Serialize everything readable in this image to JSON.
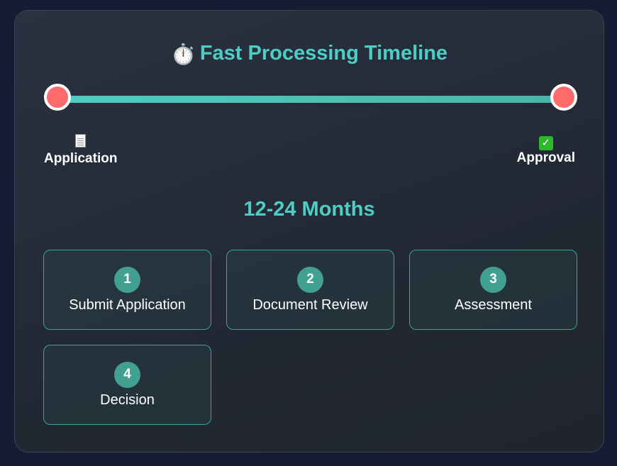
{
  "header": {
    "icon": "stopwatch-icon",
    "emoji": "⏱️",
    "title": "Fast Processing Timeline"
  },
  "timeline": {
    "start": {
      "icon": "document-icon",
      "label": "Application"
    },
    "end": {
      "icon": "check-mark-icon",
      "label": "Approval"
    },
    "duration": "12-24 Months"
  },
  "steps": [
    {
      "number": "1",
      "label": "Submit Application"
    },
    {
      "number": "2",
      "label": "Document Review"
    },
    {
      "number": "3",
      "label": "Assessment"
    },
    {
      "number": "4",
      "label": "Decision"
    }
  ],
  "colors": {
    "accent": "#4ecdc4",
    "marker": "#ff6b6b",
    "step_badge": "#41a091",
    "background": "#161c33"
  }
}
